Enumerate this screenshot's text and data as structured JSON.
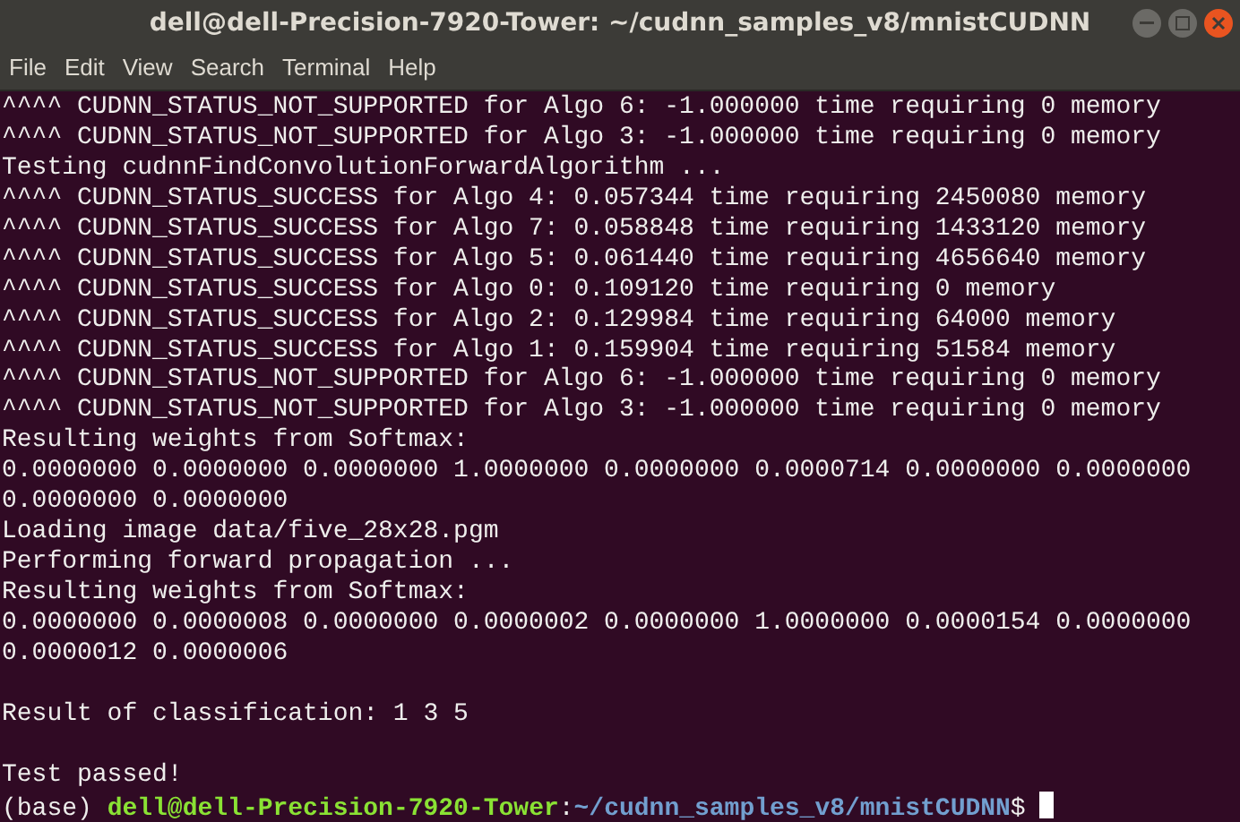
{
  "window": {
    "title": "dell@dell-Precision-7920-Tower: ~/cudnn_samples_v8/mnistCUDNN"
  },
  "menu": [
    "File",
    "Edit",
    "View",
    "Search",
    "Terminal",
    "Help"
  ],
  "terminal": {
    "lines": [
      {
        "kind": "output",
        "text": "^^^^ CUDNN_STATUS_NOT_SUPPORTED for Algo 6: -1.000000 time requiring 0 memory"
      },
      {
        "kind": "output",
        "text": "^^^^ CUDNN_STATUS_NOT_SUPPORTED for Algo 3: -1.000000 time requiring 0 memory"
      },
      {
        "kind": "output",
        "text": "Testing cudnnFindConvolutionForwardAlgorithm ..."
      },
      {
        "kind": "output",
        "text": "^^^^ CUDNN_STATUS_SUCCESS for Algo 4: 0.057344 time requiring 2450080 memory"
      },
      {
        "kind": "output",
        "text": "^^^^ CUDNN_STATUS_SUCCESS for Algo 7: 0.058848 time requiring 1433120 memory"
      },
      {
        "kind": "output",
        "text": "^^^^ CUDNN_STATUS_SUCCESS for Algo 5: 0.061440 time requiring 4656640 memory"
      },
      {
        "kind": "output",
        "text": "^^^^ CUDNN_STATUS_SUCCESS for Algo 0: 0.109120 time requiring 0 memory"
      },
      {
        "kind": "output",
        "text": "^^^^ CUDNN_STATUS_SUCCESS for Algo 2: 0.129984 time requiring 64000 memory"
      },
      {
        "kind": "output",
        "text": "^^^^ CUDNN_STATUS_SUCCESS for Algo 1: 0.159904 time requiring 51584 memory"
      },
      {
        "kind": "output",
        "text": "^^^^ CUDNN_STATUS_NOT_SUPPORTED for Algo 6: -1.000000 time requiring 0 memory"
      },
      {
        "kind": "output",
        "text": "^^^^ CUDNN_STATUS_NOT_SUPPORTED for Algo 3: -1.000000 time requiring 0 memory"
      },
      {
        "kind": "output",
        "text": "Resulting weights from Softmax:"
      },
      {
        "kind": "output",
        "text": "0.0000000 0.0000000 0.0000000 1.0000000 0.0000000 0.0000714 0.0000000 0.0000000"
      },
      {
        "kind": "output",
        "text": "0.0000000 0.0000000"
      },
      {
        "kind": "output",
        "text": "Loading image data/five_28x28.pgm"
      },
      {
        "kind": "output",
        "text": "Performing forward propagation ..."
      },
      {
        "kind": "output",
        "text": "Resulting weights from Softmax:"
      },
      {
        "kind": "output",
        "text": "0.0000000 0.0000008 0.0000000 0.0000002 0.0000000 1.0000000 0.0000154 0.0000000"
      },
      {
        "kind": "output",
        "text": "0.0000012 0.0000006"
      },
      {
        "kind": "blank"
      },
      {
        "kind": "output",
        "text": "Result of classification: 1 3 5"
      },
      {
        "kind": "blank"
      },
      {
        "kind": "output",
        "text": "Test passed!"
      }
    ],
    "prompt": {
      "env": "(base)",
      "user_host": "dell@dell-Precision-7920-Tower",
      "separator": ":",
      "path": "~/cudnn_samples_v8/mnistCUDNN",
      "symbol": "$"
    }
  }
}
